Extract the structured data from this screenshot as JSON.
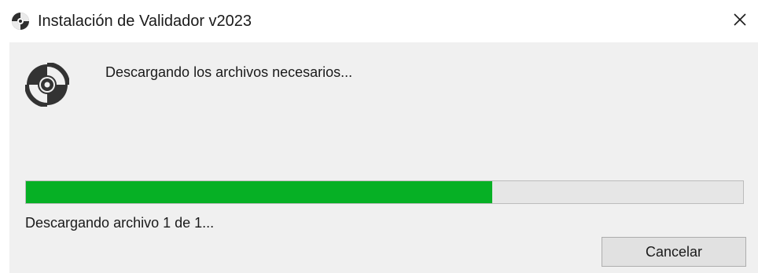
{
  "window": {
    "title": "Instalación de Validador v2023",
    "app_icon": "disc-icon",
    "close_icon": "close-icon"
  },
  "main": {
    "icon": "disc-icon",
    "heading": "Descargando los archivos necesarios...",
    "progress": {
      "percent": 65,
      "fill_color": "#06b025",
      "track_color": "#e6e6e6"
    },
    "status": "Descargando archivo 1 de 1...",
    "cancel_label": "Cancelar"
  }
}
